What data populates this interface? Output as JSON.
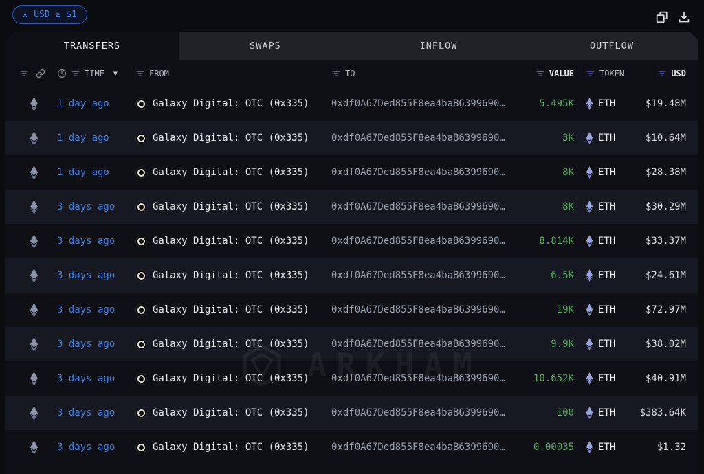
{
  "filter_bar": {
    "chip": {
      "close_icon": "✕",
      "label": "USD ≥ $1"
    }
  },
  "toolbar": {
    "icons": [
      {
        "name": "copy-icon"
      },
      {
        "name": "download-icon"
      }
    ]
  },
  "tabs": [
    {
      "label": "TRANSFERS",
      "active": true
    },
    {
      "label": "SWAPS",
      "active": false
    },
    {
      "label": "INFLOW",
      "active": false
    },
    {
      "label": "OUTFLOW",
      "active": false
    }
  ],
  "table": {
    "columns": {
      "time": "TIME",
      "from": "FROM",
      "to": "TO",
      "value": "VALUE",
      "token": "TOKEN",
      "usd": "USD"
    },
    "rows": [
      {
        "chain": "ethereum",
        "time": "1 day ago",
        "from": "Galaxy Digital: OTC (0x335)",
        "to": "0xdf0A67Ded855F8ea4baB6399690…",
        "value": "5.495K",
        "token": "ETH",
        "usd": "$19.48M"
      },
      {
        "chain": "ethereum",
        "time": "1 day ago",
        "from": "Galaxy Digital: OTC (0x335)",
        "to": "0xdf0A67Ded855F8ea4baB6399690…",
        "value": "3K",
        "token": "ETH",
        "usd": "$10.64M"
      },
      {
        "chain": "ethereum",
        "time": "1 day ago",
        "from": "Galaxy Digital: OTC (0x335)",
        "to": "0xdf0A67Ded855F8ea4baB6399690…",
        "value": "8K",
        "token": "ETH",
        "usd": "$28.38M"
      },
      {
        "chain": "ethereum",
        "time": "3 days ago",
        "from": "Galaxy Digital: OTC (0x335)",
        "to": "0xdf0A67Ded855F8ea4baB6399690…",
        "value": "8K",
        "token": "ETH",
        "usd": "$30.29M"
      },
      {
        "chain": "ethereum",
        "time": "3 days ago",
        "from": "Galaxy Digital: OTC (0x335)",
        "to": "0xdf0A67Ded855F8ea4baB6399690…",
        "value": "8.814K",
        "token": "ETH",
        "usd": "$33.37M"
      },
      {
        "chain": "ethereum",
        "time": "3 days ago",
        "from": "Galaxy Digital: OTC (0x335)",
        "to": "0xdf0A67Ded855F8ea4baB6399690…",
        "value": "6.5K",
        "token": "ETH",
        "usd": "$24.61M"
      },
      {
        "chain": "ethereum",
        "time": "3 days ago",
        "from": "Galaxy Digital: OTC (0x335)",
        "to": "0xdf0A67Ded855F8ea4baB6399690…",
        "value": "19K",
        "token": "ETH",
        "usd": "$72.97M"
      },
      {
        "chain": "ethereum",
        "time": "3 days ago",
        "from": "Galaxy Digital: OTC (0x335)",
        "to": "0xdf0A67Ded855F8ea4baB6399690…",
        "value": "9.9K",
        "token": "ETH",
        "usd": "$38.02M"
      },
      {
        "chain": "ethereum",
        "time": "3 days ago",
        "from": "Galaxy Digital: OTC (0x335)",
        "to": "0xdf0A67Ded855F8ea4baB6399690…",
        "value": "10.652K",
        "token": "ETH",
        "usd": "$40.91M"
      },
      {
        "chain": "ethereum",
        "time": "3 days ago",
        "from": "Galaxy Digital: OTC (0x335)",
        "to": "0xdf0A67Ded855F8ea4baB6399690…",
        "value": "100",
        "token": "ETH",
        "usd": "$383.64K"
      },
      {
        "chain": "ethereum",
        "time": "3 days ago",
        "from": "Galaxy Digital: OTC (0x335)",
        "to": "0xdf0A67Ded855F8ea4baB6399690…",
        "value": "0.00035",
        "token": "ETH",
        "usd": "$1.32"
      }
    ]
  },
  "watermark": {
    "text": "ARKHAM"
  },
  "colors": {
    "page_bg": "#0a0c10",
    "panel_bg": "#0e1016",
    "row_alt_bg": "#171922",
    "tab_inactive_bg": "#202228",
    "accent_blue": "#3c7de2",
    "chip_blue": "#4d84ec",
    "value_green": "#5aab64",
    "filter_purple": "#6c63e0",
    "eth_token_purple": "#8d96d8",
    "address_gray": "#9ba1ac"
  }
}
